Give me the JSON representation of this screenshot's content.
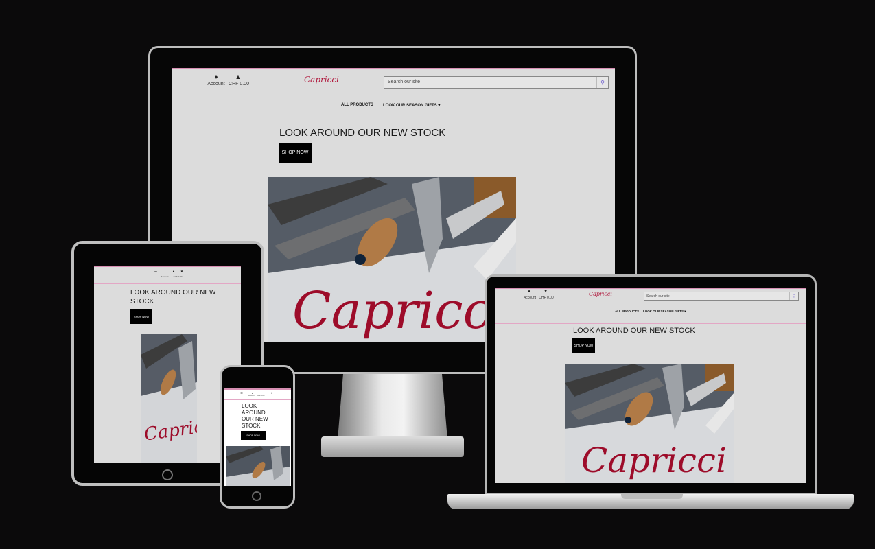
{
  "site": {
    "brand": "Capricci",
    "account_label": "Account",
    "cart_label": "CHF 0.00",
    "search_placeholder": "Search our site",
    "nav": {
      "all_products": "ALL PRODUCTS",
      "season_gifts": "LOOK OUR SEASON GIFTS",
      "season_caret": "▾"
    },
    "hero": {
      "heading": "LOOK AROUND OUR NEW STOCK",
      "tablet_heading_line1": "LOOK AROUND OUR NEW",
      "tablet_heading_line2": "STOCK",
      "phone_heading_line1": "LOOK",
      "phone_heading_line2": "AROUND",
      "phone_heading_line3": "OUR NEW",
      "phone_heading_line4": "STOCK",
      "button": "SHOP NOW",
      "image_script": "Capricci"
    }
  },
  "icons": {
    "account": "user-icon",
    "cart": "cart-icon",
    "search": "search-icon",
    "menu": "menu-icon"
  },
  "colors": {
    "background": "#0b0a0b",
    "brand_red": "#b0173c",
    "accent_pink": "#d78fb3",
    "button_bg": "#000000"
  }
}
